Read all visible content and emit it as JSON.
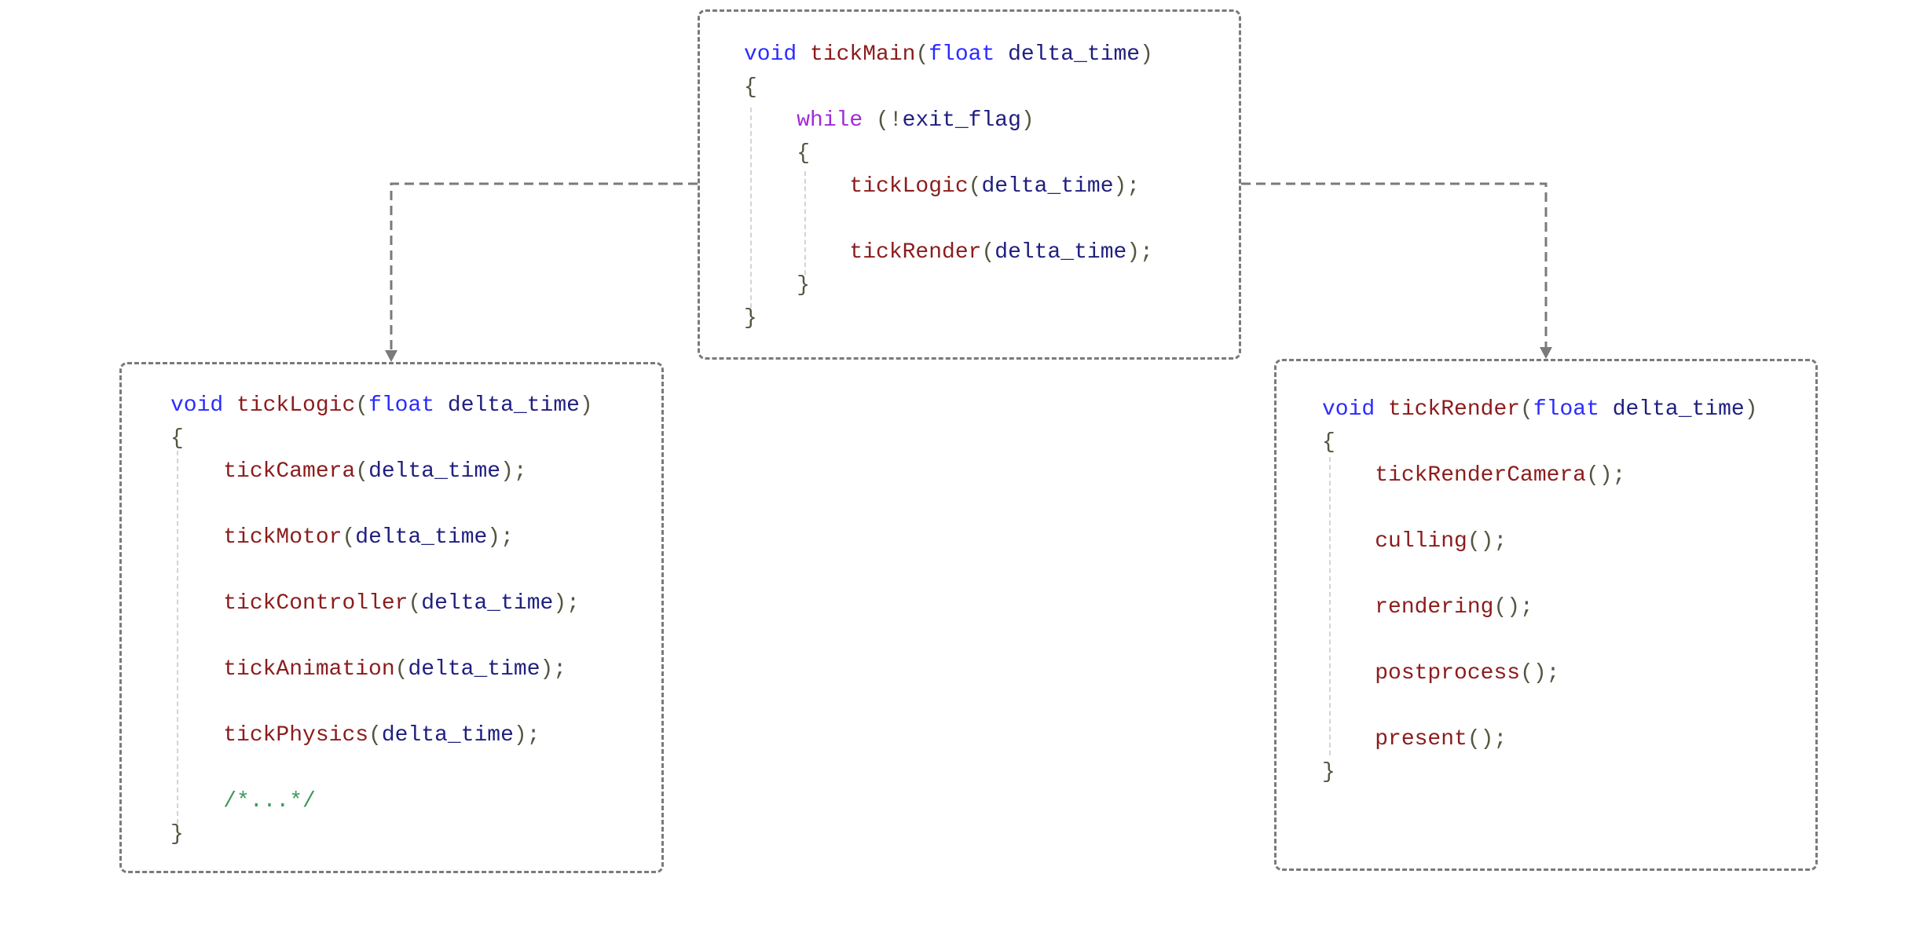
{
  "boxes": {
    "main": [
      [
        [
          "void ",
          "kw"
        ],
        [
          "tickMain",
          "fn"
        ],
        [
          "(",
          "p"
        ],
        [
          "float ",
          "kw"
        ],
        [
          "delta_time",
          "id"
        ],
        [
          ")",
          "p"
        ]
      ],
      [
        [
          "{",
          "p"
        ]
      ],
      [
        [
          "    ",
          "p"
        ],
        [
          "while ",
          "kw2"
        ],
        [
          "(!",
          "p"
        ],
        [
          "exit_flag",
          "id"
        ],
        [
          ")",
          "p"
        ]
      ],
      [
        [
          "    {",
          "p"
        ]
      ],
      [
        [
          "        ",
          "p"
        ],
        [
          "tickLogic",
          "fn"
        ],
        [
          "(",
          "p"
        ],
        [
          "delta_time",
          "id"
        ],
        [
          ");",
          "p"
        ]
      ],
      [],
      [
        [
          "        ",
          "p"
        ],
        [
          "tickRender",
          "fn"
        ],
        [
          "(",
          "p"
        ],
        [
          "delta_time",
          "id"
        ],
        [
          ");",
          "p"
        ]
      ],
      [
        [
          "    }",
          "p"
        ]
      ],
      [
        [
          "}",
          "p"
        ]
      ]
    ],
    "logic": [
      [
        [
          "void ",
          "kw"
        ],
        [
          "tickLogic",
          "fn"
        ],
        [
          "(",
          "p"
        ],
        [
          "float ",
          "kw"
        ],
        [
          "delta_time",
          "id"
        ],
        [
          ")",
          "p"
        ]
      ],
      [
        [
          "{",
          "p"
        ]
      ],
      [
        [
          "    ",
          "p"
        ],
        [
          "tickCamera",
          "fn"
        ],
        [
          "(",
          "p"
        ],
        [
          "delta_time",
          "id"
        ],
        [
          ");",
          "p"
        ]
      ],
      [],
      [
        [
          "    ",
          "p"
        ],
        [
          "tickMotor",
          "fn"
        ],
        [
          "(",
          "p"
        ],
        [
          "delta_time",
          "id"
        ],
        [
          ");",
          "p"
        ]
      ],
      [],
      [
        [
          "    ",
          "p"
        ],
        [
          "tickController",
          "fn"
        ],
        [
          "(",
          "p"
        ],
        [
          "delta_time",
          "id"
        ],
        [
          ");",
          "p"
        ]
      ],
      [],
      [
        [
          "    ",
          "p"
        ],
        [
          "tickAnimation",
          "fn"
        ],
        [
          "(",
          "p"
        ],
        [
          "delta_time",
          "id"
        ],
        [
          ");",
          "p"
        ]
      ],
      [],
      [
        [
          "    ",
          "p"
        ],
        [
          "tickPhysics",
          "fn"
        ],
        [
          "(",
          "p"
        ],
        [
          "delta_time",
          "id"
        ],
        [
          ");",
          "p"
        ]
      ],
      [],
      [
        [
          "    ",
          "p"
        ],
        [
          "/*...*/",
          "cm"
        ]
      ],
      [
        [
          "}",
          "p"
        ]
      ]
    ],
    "render": [
      [
        [
          "void ",
          "kw"
        ],
        [
          "tickRender",
          "fn"
        ],
        [
          "(",
          "p"
        ],
        [
          "float ",
          "kw"
        ],
        [
          "delta_time",
          "id"
        ],
        [
          ")",
          "p"
        ]
      ],
      [
        [
          "{",
          "p"
        ]
      ],
      [
        [
          "    ",
          "p"
        ],
        [
          "tickRenderCamera",
          "fn"
        ],
        [
          "();",
          "p"
        ]
      ],
      [],
      [
        [
          "    ",
          "p"
        ],
        [
          "culling",
          "fn"
        ],
        [
          "();",
          "p"
        ]
      ],
      [],
      [
        [
          "    ",
          "p"
        ],
        [
          "rendering",
          "fn"
        ],
        [
          "();",
          "p"
        ]
      ],
      [],
      [
        [
          "    ",
          "p"
        ],
        [
          "postprocess",
          "fn"
        ],
        [
          "();",
          "p"
        ]
      ],
      [],
      [
        [
          "    ",
          "p"
        ],
        [
          "present",
          "fn"
        ],
        [
          "();",
          "p"
        ]
      ],
      [
        [
          "}",
          "p"
        ]
      ]
    ]
  },
  "colors": {
    "border": "#7a7a7a",
    "keyword": "#2b2bff",
    "control": "#a12bd6",
    "function": "#8c1c1c",
    "identifier": "#1f1f80",
    "comment": "#3a9a58"
  }
}
